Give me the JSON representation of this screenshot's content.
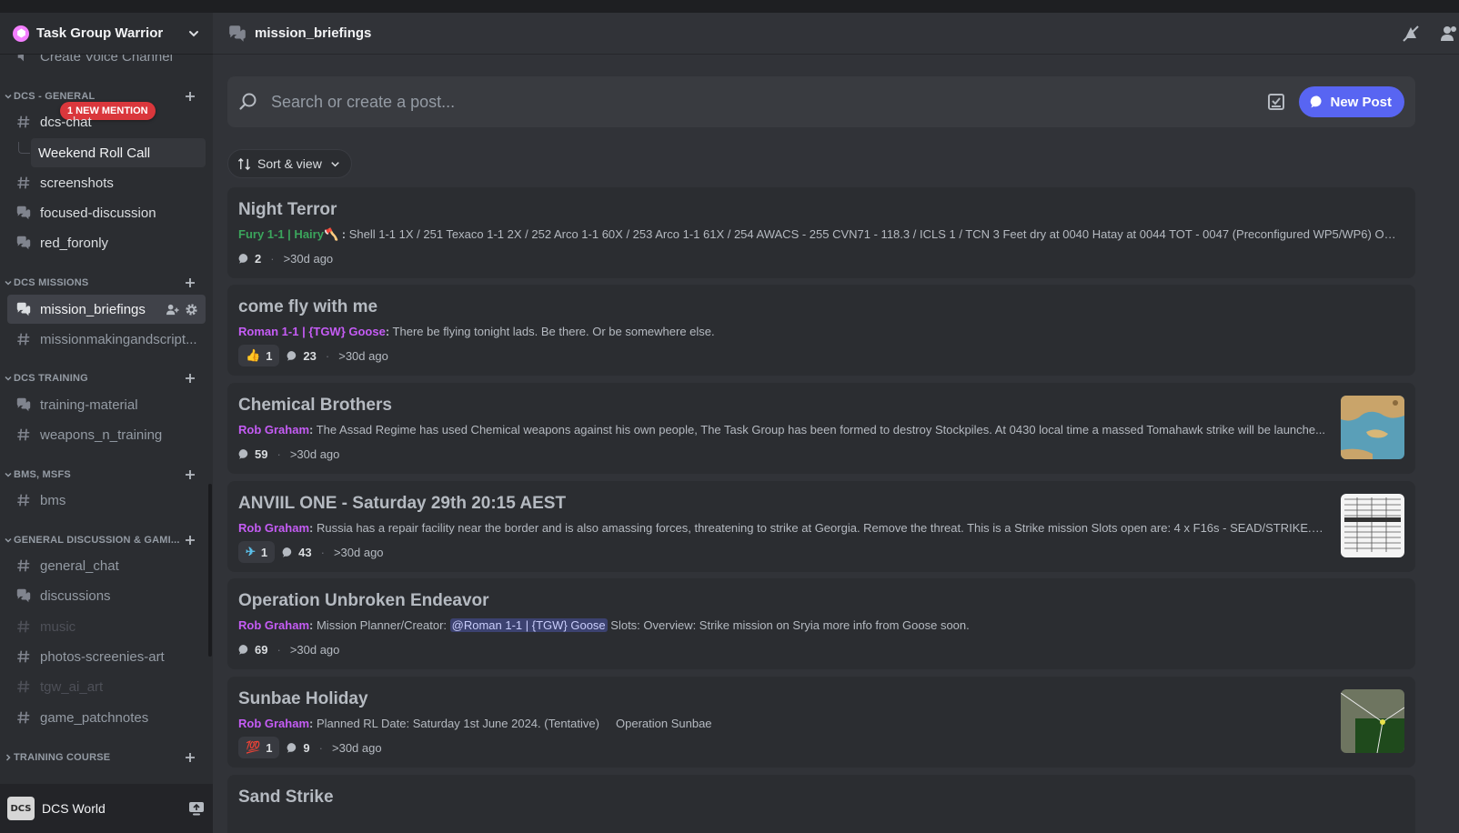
{
  "server": {
    "name": "Task Group Warrior"
  },
  "sidebar": {
    "partial_channel": "Create Voice Channel",
    "mention_pill": "1 NEW MENTION",
    "categories": [
      {
        "label": "DCS - GENERAL"
      },
      {
        "label": "DCS MISSIONS"
      },
      {
        "label": "DCS TRAINING"
      },
      {
        "label": "BMS, MSFS"
      },
      {
        "label": "GENERAL DISCUSSION & GAMI..."
      },
      {
        "label": "TRAINING COURSE"
      }
    ],
    "channels": [
      {
        "label": "dcs-chat",
        "icon": "hash-icon"
      },
      {
        "label": "Weekend Roll Call",
        "icon": "thread-icon"
      },
      {
        "label": "screenshots",
        "icon": "hash-icon"
      },
      {
        "label": "focused-discussion",
        "icon": "forum-icon"
      },
      {
        "label": "red_foronly",
        "icon": "forum-icon"
      },
      {
        "label": "mission_briefings",
        "icon": "forum-icon"
      },
      {
        "label": "missionmakingandscript...",
        "icon": "hash-icon"
      },
      {
        "label": "training-material",
        "icon": "forum-icon"
      },
      {
        "label": "weapons_n_training",
        "icon": "hash-icon"
      },
      {
        "label": "bms",
        "icon": "hash-icon"
      },
      {
        "label": "general_chat",
        "icon": "hash-icon"
      },
      {
        "label": "discussions",
        "icon": "forum-icon"
      },
      {
        "label": "music",
        "icon": "hash-icon"
      },
      {
        "label": "photos-screenies-art",
        "icon": "hash-icon"
      },
      {
        "label": "tgw_ai_art",
        "icon": "hash-icon"
      },
      {
        "label": "game_patchnotes",
        "icon": "hash-icon"
      }
    ],
    "voice": {
      "name": "DCS World",
      "avatar_text": "DCS"
    }
  },
  "channel": {
    "title": "mission_briefings"
  },
  "search": {
    "placeholder": "Search or create a post..."
  },
  "new_post_label": "New Post",
  "sort_label": "Sort & view",
  "colors": {
    "accent": "#5865f2",
    "green_author": "#3ba55c",
    "purple_author": "#c55cf5",
    "mention_red": "#da373c"
  },
  "posts": [
    {
      "title": "Night Terror",
      "author": "Fury 1-1 | Hairy",
      "author_suffix": "🪓",
      "body": " Shell 1-1 1X / 251 Texaco 1-1 2X / 252 Arco 1-1 60X / 253 Arco 1-1 61X / 254 AWACS - 255 CVN71 - 118.3 / ICLS 1 / TCN 3 Feet dry at 0040 Hatay at 0044 TOT - 0047 (Preconfigured WP5/WP6) Objecti...",
      "comments": "2",
      "age": ">30d ago"
    },
    {
      "title": "come fly with me",
      "author": "Roman 1-1 | {TGW} Goose",
      "body": " There be flying tonight lads. Be there. Or be somewhere else.",
      "reaction_emoji": "👍",
      "reaction_count": "1",
      "comments": "23",
      "age": ">30d ago"
    },
    {
      "title": "Chemical Brothers",
      "author": "Rob Graham",
      "body": " The Assad Regime has used Chemical weapons against his own people, The Task Group has been formed to destroy Stockpiles. At 0430 local time a massed Tomahawk strike will be launche...",
      "comments": "59",
      "age": ">30d ago",
      "thumbnail": "map-thumbnail"
    },
    {
      "title": "ANVIIL ONE - Saturday 29th 20:15 AEST",
      "author": "Rob Graham",
      "body": " Russia has a repair facility near the border and is also amassing forces, threatening to strike at Georgia. Remove the threat. This is a Strike mission Slots open are: 4 x F16s - SEAD/STRIKE. 2...",
      "reaction_emoji": "✈",
      "reaction_count": "1",
      "comments": "43",
      "age": ">30d ago",
      "thumbnail": "document-thumbnail"
    },
    {
      "title": "Operation Unbroken Endeavor",
      "author": "Rob Graham",
      "body_pre": " Mission Planner/Creator: ",
      "mention": "@Roman 1-1 | {TGW} Goose",
      "body_post": " Slots: Overview: Strike mission on Sryia more info from Goose soon.",
      "comments": "69",
      "age": ">30d ago"
    },
    {
      "title": "Sunbae Holiday",
      "author": "Rob Graham",
      "body": " Planned RL Date: Saturday 1st June 2024. (Tentative)     Operation Sunbae",
      "reaction_emoji": "💯",
      "reaction_count": "1",
      "comments": "9",
      "age": ">30d ago",
      "thumbnail": "terrain-thumbnail"
    },
    {
      "title": "Sand Strike"
    }
  ]
}
